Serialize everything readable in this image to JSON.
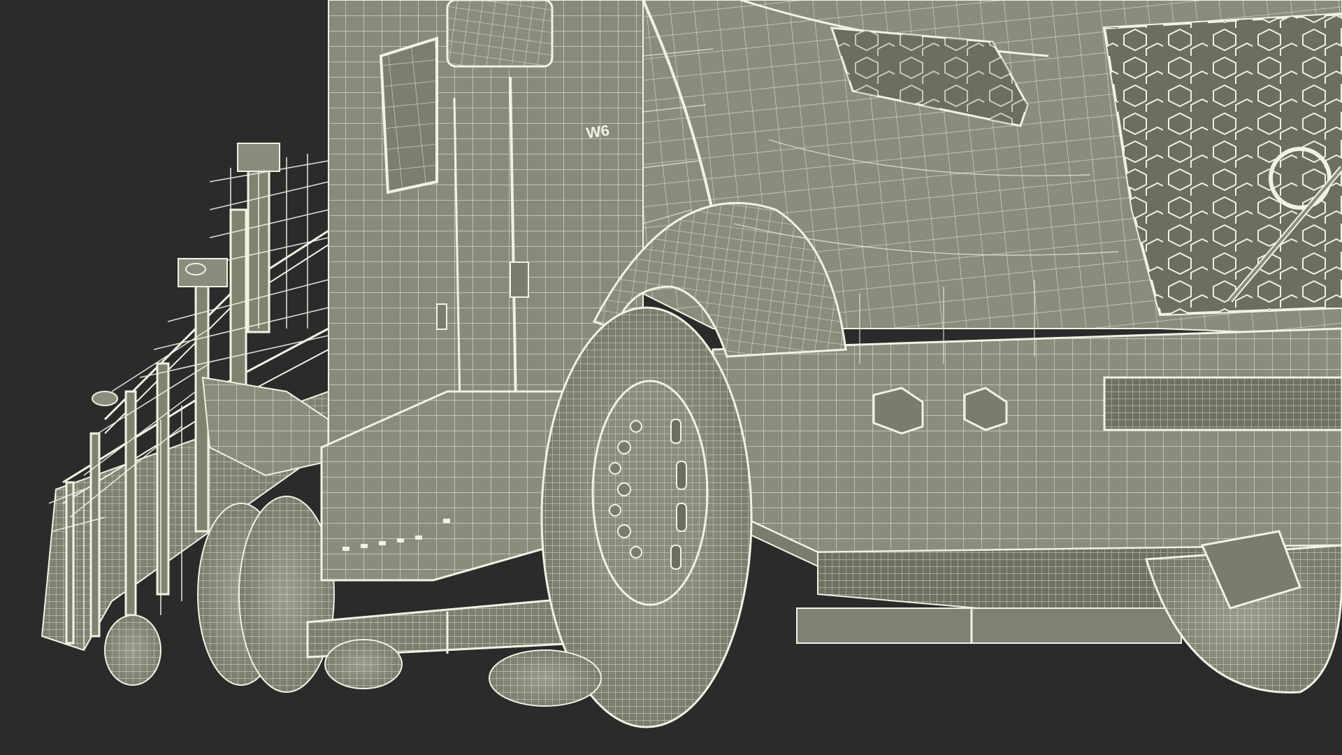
{
  "scene": {
    "background_color": "#2b2b2b",
    "body_fill": "#8a8d7c",
    "body_fill_dark": "#6f7263",
    "body_fill_light": "#9a9d8b",
    "wire_color": "#f3f1e4",
    "wire_color_dim": "#c9c8b8",
    "tire_fill": "#84877a",
    "badge_text": "W6"
  }
}
